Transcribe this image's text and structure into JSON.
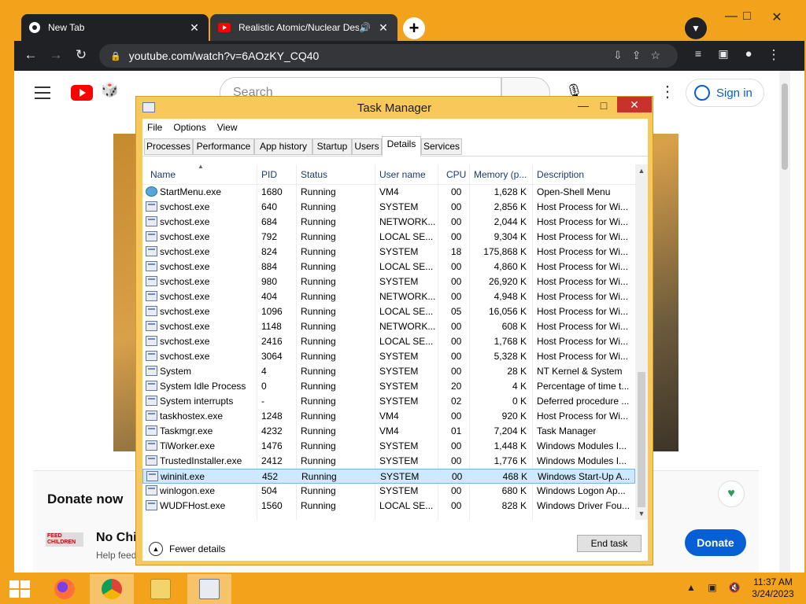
{
  "browser": {
    "tabs": [
      {
        "title": "New Tab"
      },
      {
        "title": "Realistic Atomic/Nuclear Des"
      }
    ],
    "new_tab_label": "+",
    "url": "youtube.com/watch?v=6AOzKY_CQ40"
  },
  "youtube": {
    "search_placeholder": "Search",
    "sign_in": "Sign in",
    "donate_card": {
      "title": "Donate now",
      "headline": "No Chil",
      "subtext": "Help feed",
      "logo_text": "FEED CHILDREN",
      "button": "Donate"
    }
  },
  "task_manager": {
    "title": "Task Manager",
    "menu": [
      "File",
      "Options",
      "View"
    ],
    "tabs": [
      "Processes",
      "Performance",
      "App history",
      "Startup",
      "Users",
      "Details",
      "Services"
    ],
    "active_tab": "Details",
    "columns": [
      "Name",
      "PID",
      "Status",
      "User name",
      "CPU",
      "Memory (p...",
      "Description"
    ],
    "rows": [
      {
        "name": "StartMenu.exe",
        "pid": "1680",
        "status": "Running",
        "user": "VM4",
        "cpu": "00",
        "memory": "1,628 K",
        "desc": "Open-Shell Menu",
        "icon": "globe-icon"
      },
      {
        "name": "svchost.exe",
        "pid": "640",
        "status": "Running",
        "user": "SYSTEM",
        "cpu": "00",
        "memory": "2,856 K",
        "desc": "Host Process for Wi..."
      },
      {
        "name": "svchost.exe",
        "pid": "684",
        "status": "Running",
        "user": "NETWORK...",
        "cpu": "00",
        "memory": "2,044 K",
        "desc": "Host Process for Wi..."
      },
      {
        "name": "svchost.exe",
        "pid": "792",
        "status": "Running",
        "user": "LOCAL SE...",
        "cpu": "00",
        "memory": "9,304 K",
        "desc": "Host Process for Wi..."
      },
      {
        "name": "svchost.exe",
        "pid": "824",
        "status": "Running",
        "user": "SYSTEM",
        "cpu": "18",
        "memory": "175,868 K",
        "desc": "Host Process for Wi..."
      },
      {
        "name": "svchost.exe",
        "pid": "884",
        "status": "Running",
        "user": "LOCAL SE...",
        "cpu": "00",
        "memory": "4,860 K",
        "desc": "Host Process for Wi..."
      },
      {
        "name": "svchost.exe",
        "pid": "980",
        "status": "Running",
        "user": "SYSTEM",
        "cpu": "00",
        "memory": "26,920 K",
        "desc": "Host Process for Wi..."
      },
      {
        "name": "svchost.exe",
        "pid": "404",
        "status": "Running",
        "user": "NETWORK...",
        "cpu": "00",
        "memory": "4,948 K",
        "desc": "Host Process for Wi..."
      },
      {
        "name": "svchost.exe",
        "pid": "1096",
        "status": "Running",
        "user": "LOCAL SE...",
        "cpu": "05",
        "memory": "16,056 K",
        "desc": "Host Process for Wi..."
      },
      {
        "name": "svchost.exe",
        "pid": "1148",
        "status": "Running",
        "user": "NETWORK...",
        "cpu": "00",
        "memory": "608 K",
        "desc": "Host Process for Wi..."
      },
      {
        "name": "svchost.exe",
        "pid": "2416",
        "status": "Running",
        "user": "LOCAL SE...",
        "cpu": "00",
        "memory": "1,768 K",
        "desc": "Host Process for Wi..."
      },
      {
        "name": "svchost.exe",
        "pid": "3064",
        "status": "Running",
        "user": "SYSTEM",
        "cpu": "00",
        "memory": "5,328 K",
        "desc": "Host Process for Wi..."
      },
      {
        "name": "System",
        "pid": "4",
        "status": "Running",
        "user": "SYSTEM",
        "cpu": "00",
        "memory": "28 K",
        "desc": "NT Kernel & System"
      },
      {
        "name": "System Idle Process",
        "pid": "0",
        "status": "Running",
        "user": "SYSTEM",
        "cpu": "20",
        "memory": "4 K",
        "desc": "Percentage of time t..."
      },
      {
        "name": "System interrupts",
        "pid": "-",
        "status": "Running",
        "user": "SYSTEM",
        "cpu": "02",
        "memory": "0 K",
        "desc": "Deferred procedure ..."
      },
      {
        "name": "taskhostex.exe",
        "pid": "1248",
        "status": "Running",
        "user": "VM4",
        "cpu": "00",
        "memory": "920 K",
        "desc": "Host Process for Wi..."
      },
      {
        "name": "Taskmgr.exe",
        "pid": "4232",
        "status": "Running",
        "user": "VM4",
        "cpu": "01",
        "memory": "7,204 K",
        "desc": "Task Manager"
      },
      {
        "name": "TiWorker.exe",
        "pid": "1476",
        "status": "Running",
        "user": "SYSTEM",
        "cpu": "00",
        "memory": "1,448 K",
        "desc": "Windows Modules I..."
      },
      {
        "name": "TrustedInstaller.exe",
        "pid": "2412",
        "status": "Running",
        "user": "SYSTEM",
        "cpu": "00",
        "memory": "1,776 K",
        "desc": "Windows Modules I..."
      },
      {
        "name": "wininit.exe",
        "pid": "452",
        "status": "Running",
        "user": "SYSTEM",
        "cpu": "00",
        "memory": "468 K",
        "desc": "Windows Start-Up A...",
        "selected": true
      },
      {
        "name": "winlogon.exe",
        "pid": "504",
        "status": "Running",
        "user": "SYSTEM",
        "cpu": "00",
        "memory": "680 K",
        "desc": "Windows Logon Ap..."
      },
      {
        "name": "WUDFHost.exe",
        "pid": "1560",
        "status": "Running",
        "user": "LOCAL SE...",
        "cpu": "00",
        "memory": "828 K",
        "desc": "Windows Driver Fou..."
      }
    ],
    "fewer_details": "Fewer details",
    "end_task": "End task"
  },
  "taskbar": {
    "clock_time": "11:37 AM",
    "clock_date": "3/24/2023"
  },
  "colors": {
    "desktop": "#f2a31b",
    "chrome_dark": "#202124",
    "youtube_red": "#ff0000",
    "youtube_blue": "#065fd4",
    "tm_close": "#c7322c",
    "selection": "#cde8ff"
  }
}
